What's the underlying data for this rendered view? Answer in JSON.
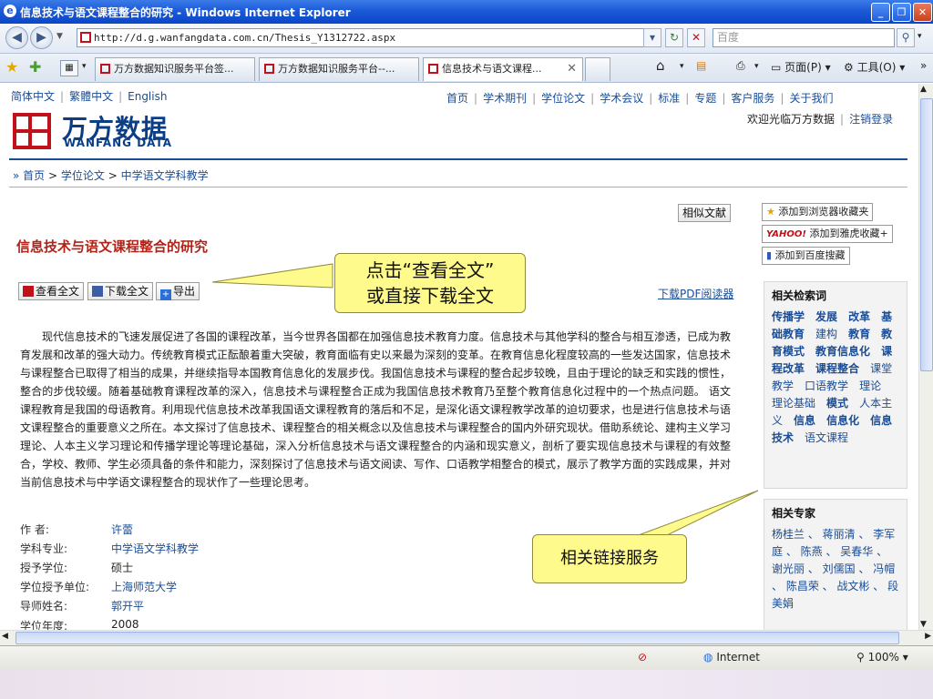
{
  "window": {
    "title": "信息技术与语文课程整合的研究 - Windows Internet Explorer",
    "icon": "e"
  },
  "address": {
    "url": "http://d.g.wanfangdata.com.cn/Thesis_Y1312722.aspx",
    "search_placeholder": "百度"
  },
  "tabs": [
    {
      "label": "万方数据知识服务平台签..."
    },
    {
      "label": "万方数据知识服务平台--..."
    },
    {
      "label": "信息技术与语文课程..."
    }
  ],
  "toolbar": {
    "page": "页面(P)",
    "tools": "工具(O)"
  },
  "site": {
    "lang": [
      "简体中文",
      "繁體中文",
      "English"
    ],
    "nav": [
      "首页",
      "学术期刊",
      "学位论文",
      "学术会议",
      "标准",
      "专题",
      "客户服务",
      "关于我们"
    ],
    "welcome": "欢迎光临万方数据",
    "logout": "注销登录",
    "logo_cn": "万方数据",
    "logo_en": "WANFANG DATA"
  },
  "breadcrumb": {
    "home": "首页",
    "l2": "学位论文",
    "l3": "中学语文学科教学"
  },
  "buttons": {
    "similar": "相似文献",
    "view": "查看全文",
    "download": "下载全文",
    "export": "导出",
    "pdf_reader": "下载PDF阅读器"
  },
  "paper": {
    "title": "信息技术与语文课程整合的研究",
    "abstract": "现代信息技术的飞速发展促进了各国的课程改革，当今世界各国都在加强信息技术教育力度。信息技术与其他学科的整合与相互渗透，已成为教育发展和改革的强大动力。传统教育模式正酝酿着重大突破，教育面临有史以来最为深刻的变革。在教育信息化程度较高的一些发达国家，信息技术与课程整合已取得了相当的成果，并继续指导本国教育信息化的发展步伐。我国信息技术与课程的整合起步较晚，且由于理论的缺乏和实践的惯性，整合的步伐较缓。随着基础教育课程改革的深入，信息技术与课程整合正成为我国信息技术教育乃至整个教育信息化过程中的一个热点问题。 语文课程教育是我国的母语教育。利用现代信息技术改革我国语文课程教育的落后和不足，是深化语文课程教学改革的迫切要求，也是进行信息技术与语文课程整合的重要意义之所在。本文探讨了信息技术、课程整合的相关概念以及信息技术与课程整合的国内外研究现状。借助系统论、建构主义学习理论、人本主义学习理论和传播学理论等理论基础，深入分析信息技术与语文课程整合的内涵和现实意义，剖析了要实现信息技术与课程的有效整合，学校、教师、学生必须具备的条件和能力，深刻探讨了信息技术与语文阅读、写作、口语教学相整合的模式，展示了教学方面的实践成果，并对当前信息技术与中学语文课程整合的现状作了一些理论思考。",
    "meta": [
      {
        "k": "作    者:",
        "v": "许蕾",
        "link": true
      },
      {
        "k": "学科专业:",
        "v": "中学语文学科教学",
        "link": true
      },
      {
        "k": "授予学位:",
        "v": "硕士",
        "link": false
      },
      {
        "k": "学位授予单位:",
        "v": "上海师范大学",
        "link": true
      },
      {
        "k": "导师姓名:",
        "v": "郭开平",
        "link": true
      },
      {
        "k": "学位年度:",
        "v": "2008",
        "link": false
      }
    ]
  },
  "callouts": {
    "view_full": [
      "点击“查看全文”",
      "或直接下载全文"
    ],
    "related": "相关链接服务"
  },
  "sidebar": {
    "fav_ie": "添加到浏览器收藏夹",
    "fav_yahoo": "添加到雅虎收藏+",
    "fav_baidu": "添加到百度搜藏",
    "yahoo_logo": "YAHOO!",
    "related_terms_title": "相关检索词",
    "related_experts_title": "相关专家",
    "experts_text": "杨桂兰 、 蒋丽清 、 李军庭 、 陈燕 、 吴春华 、 谢光丽 、 刘儒国 、 冯帽 、 陈昌荣 、 战文彬 、 段美娟"
  },
  "status": {
    "zone": "Internet",
    "zoom": "100%"
  }
}
